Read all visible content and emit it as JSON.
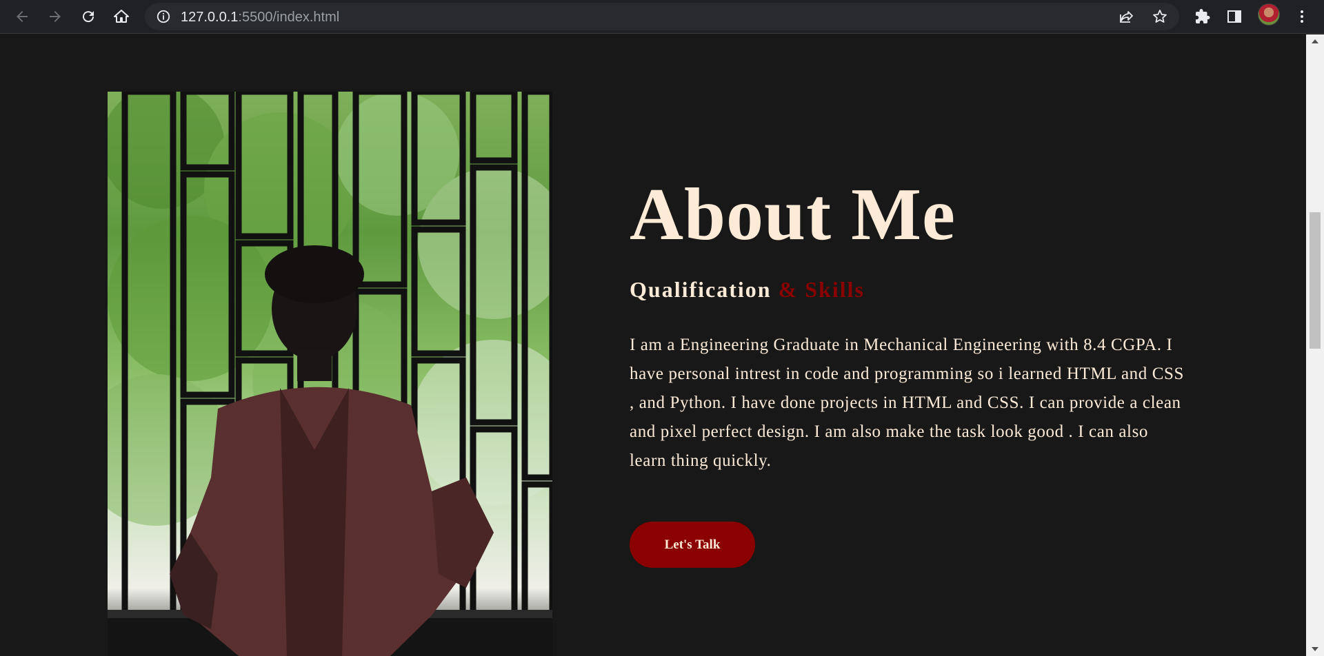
{
  "browser": {
    "url_host": "127.0.0.1",
    "url_rest": ":5500/index.html",
    "icons": [
      "back-icon",
      "forward-icon",
      "reload-icon",
      "home-icon",
      "info-icon",
      "share-icon",
      "star-icon",
      "extensions-icon",
      "side-panel-icon",
      "profile-avatar",
      "menu-icon"
    ]
  },
  "about": {
    "title": "About Me",
    "subtitle_main": "Qualification",
    "subtitle_accent": "& Skills",
    "paragraph": "I am a Engineering Graduate in Mechanical Engineering with 8.4 CGPA. I have personal intrest in code and programming so i learned HTML and CSS , and Python. I have done projects in HTML and CSS. I can provide a clean and pixel perfect design. I am also make the task look good . I can also learn thing quickly.",
    "cta_label": "Let's Talk"
  },
  "colors": {
    "background": "#181818",
    "cream": "#fdebd8",
    "accent": "#8b0000"
  }
}
